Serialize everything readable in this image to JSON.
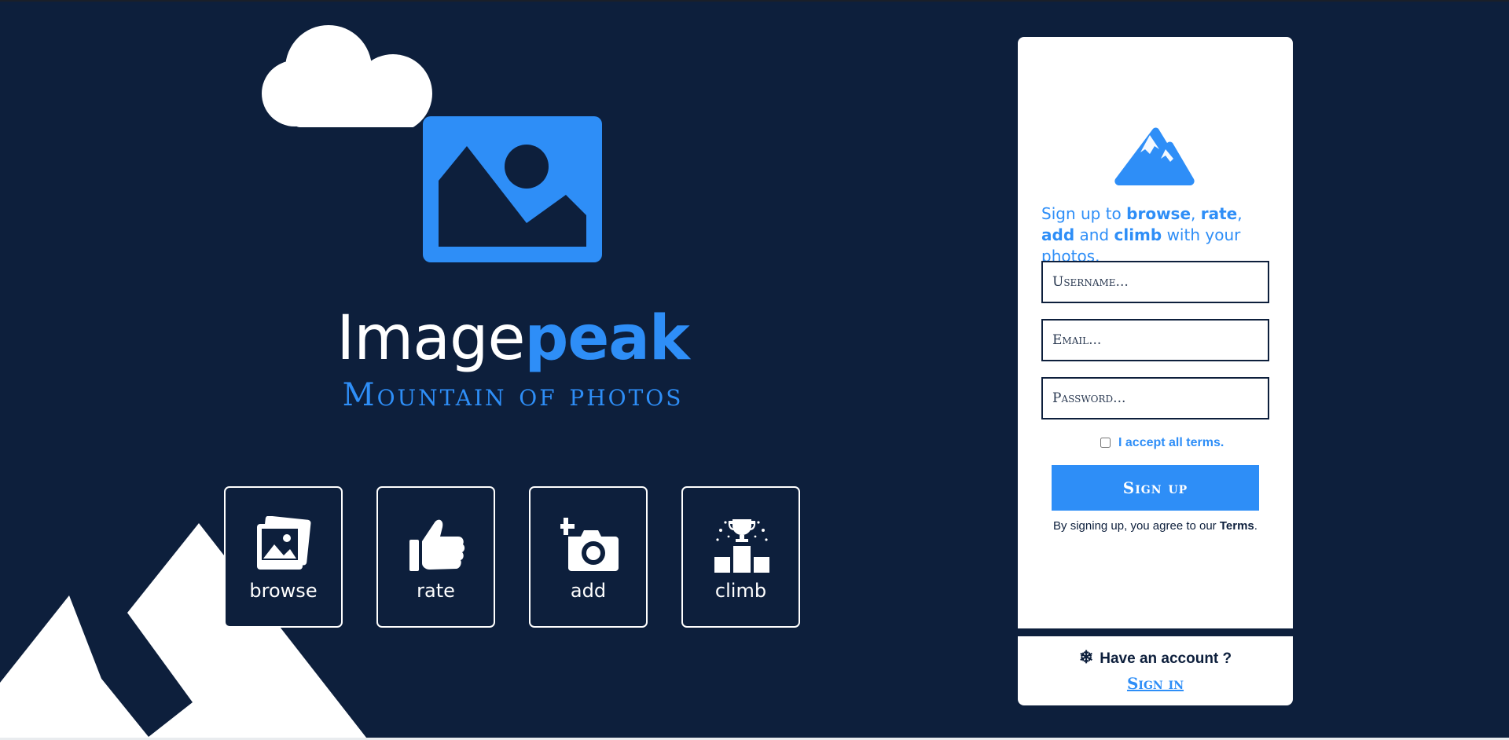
{
  "brand": {
    "title_part1": "Image",
    "title_part2": "peak",
    "tagline": "Mountain of photos"
  },
  "features": [
    {
      "label": "browse",
      "icon": "photos-icon"
    },
    {
      "label": "rate",
      "icon": "thumbs-up-icon"
    },
    {
      "label": "add",
      "icon": "add-camera-icon"
    },
    {
      "label": "climb",
      "icon": "trophy-podium-icon"
    }
  ],
  "signup": {
    "intro_1": "Sign up to ",
    "kw_browse": "browse",
    "sep_1": ", ",
    "kw_rate": "rate",
    "sep_2": ", ",
    "kw_add": "add",
    "intro_2": " and ",
    "kw_climb": "climb",
    "intro_3": " with your photos.",
    "username_placeholder": "Username...",
    "email_placeholder": "Email...",
    "password_placeholder": "Password...",
    "terms_label": "I accept all terms.",
    "button": "Sign up",
    "agree_text": "By signing up, you agree to our ",
    "terms_link": "Terms",
    "agree_end": "."
  },
  "account": {
    "question": "Have an account ?",
    "signin": "Sign in"
  },
  "colors": {
    "background": "#0d1f3c",
    "accent": "#2e8ef7",
    "card": "#ffffff"
  }
}
